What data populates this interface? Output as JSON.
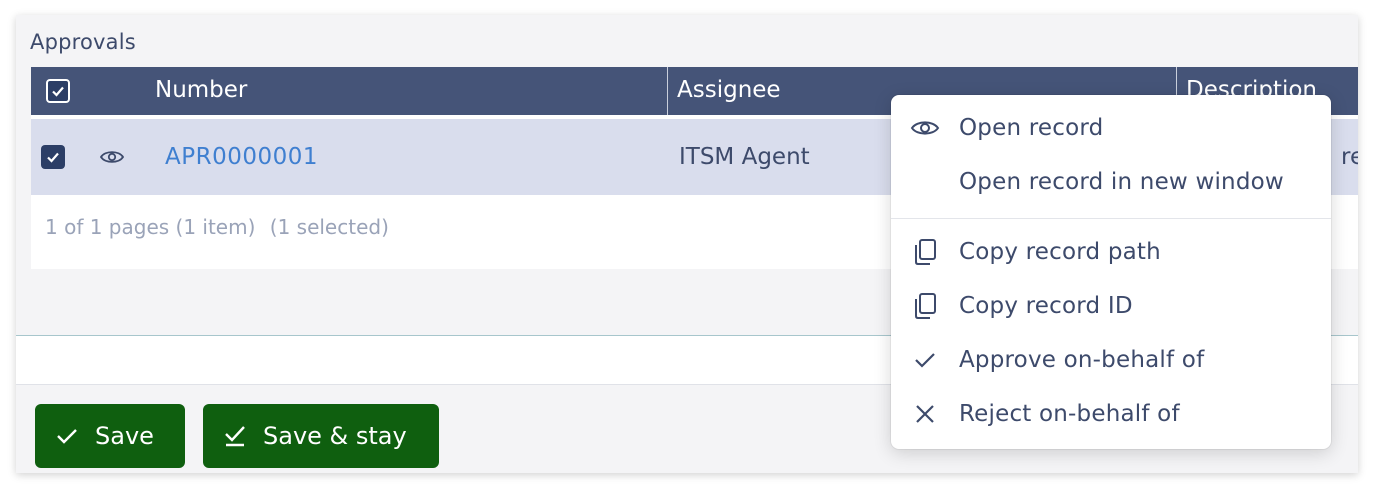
{
  "section": {
    "title": "Approvals"
  },
  "grid": {
    "columns": [
      "Number",
      "Assignee",
      "Description"
    ],
    "rows": [
      {
        "number": "APR0000001",
        "assignee": "ITSM Agent",
        "description_visible": "requ"
      }
    ],
    "pager": {
      "pages": "1 of 1 pages (1 item)",
      "selected": "(1 selected)"
    }
  },
  "context_menu": {
    "items": [
      {
        "label": "Open record",
        "icon": "eye-icon"
      },
      {
        "label": "Open record in new window",
        "icon": ""
      },
      {
        "label": "Copy record path",
        "icon": "copy-icon"
      },
      {
        "label": "Copy record ID",
        "icon": "copy-icon"
      },
      {
        "label": "Approve on-behalf of",
        "icon": "check-icon"
      },
      {
        "label": "Reject on-behalf of",
        "icon": "close-icon"
      }
    ]
  },
  "footer": {
    "save_label": "Save",
    "save_stay_label": "Save & stay"
  },
  "colors": {
    "header_bg": "#455478",
    "selected_row_bg": "#d9dded",
    "link": "#3f7fd0",
    "button_bg": "#0f5f0f"
  }
}
